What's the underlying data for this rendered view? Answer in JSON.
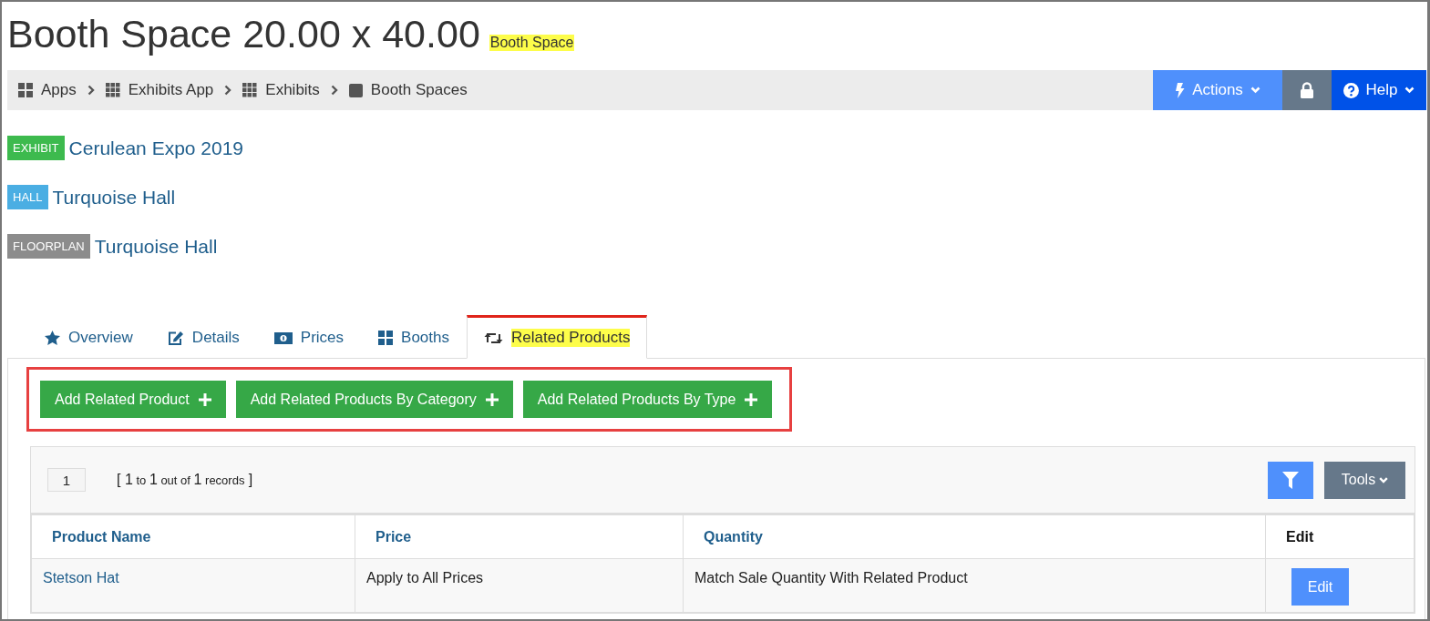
{
  "title": "Booth Space 20.00 x 40.00",
  "subtitle": {
    "text": "Booth Space",
    "highlighted": true
  },
  "breadcrumbs": [
    {
      "label": "Apps",
      "kind": "apps"
    },
    {
      "label": "Exhibits App",
      "kind": "app"
    },
    {
      "label": "Exhibits",
      "kind": "list"
    },
    {
      "label": "Booth Spaces",
      "kind": "record"
    }
  ],
  "toolbar": [
    {
      "kind": "actions",
      "label": "Actions"
    },
    {
      "kind": "lock"
    },
    {
      "kind": "help",
      "label": "Help"
    }
  ],
  "tags": [
    {
      "tag": "EXHIBIT",
      "value": "Cerulean Expo 2019",
      "color": "#3dba4e"
    },
    {
      "tag": "HALL",
      "value": "Turquoise Hall",
      "color": "#4aaee3"
    },
    {
      "tag": "FLOORPLAN",
      "value": "Turquoise Hall",
      "color": "#8c8c8c"
    }
  ],
  "tabs": [
    {
      "label": "Overview",
      "kind": "overview",
      "selected": false,
      "highlighted": false
    },
    {
      "label": "Details",
      "kind": "details",
      "selected": false,
      "highlighted": false
    },
    {
      "label": "Prices",
      "kind": "prices",
      "selected": false,
      "highlighted": false
    },
    {
      "label": "Booths",
      "kind": "booths",
      "selected": false,
      "highlighted": false
    },
    {
      "label": "Related Products",
      "kind": "related",
      "selected": true,
      "highlighted": true
    }
  ],
  "actions_outlined": true,
  "actions": [
    "Add Related Product",
    "Add Related Products By Category",
    "Add Related Products By Type"
  ],
  "pager": {
    "page": "1",
    "info": [
      {
        "text": "[ 1",
        "kind": "num"
      },
      {
        "text": " to ",
        "kind": "word"
      },
      {
        "text": "1",
        "kind": "num"
      },
      {
        "text": " out of ",
        "kind": "word"
      },
      {
        "text": "1",
        "kind": "num"
      },
      {
        "text": " records",
        "kind": "word"
      },
      {
        "text": " ]",
        "kind": "num"
      }
    ]
  },
  "tools_label": "Tools",
  "table": {
    "columns": [
      "Product Name",
      "Price",
      "Quantity",
      "Edit"
    ],
    "rows": [
      {
        "product": "Stetson Hat",
        "price": "Apply to All Prices",
        "quantity": "Match Sale Quantity With Related Product",
        "edit": "Edit"
      }
    ]
  }
}
